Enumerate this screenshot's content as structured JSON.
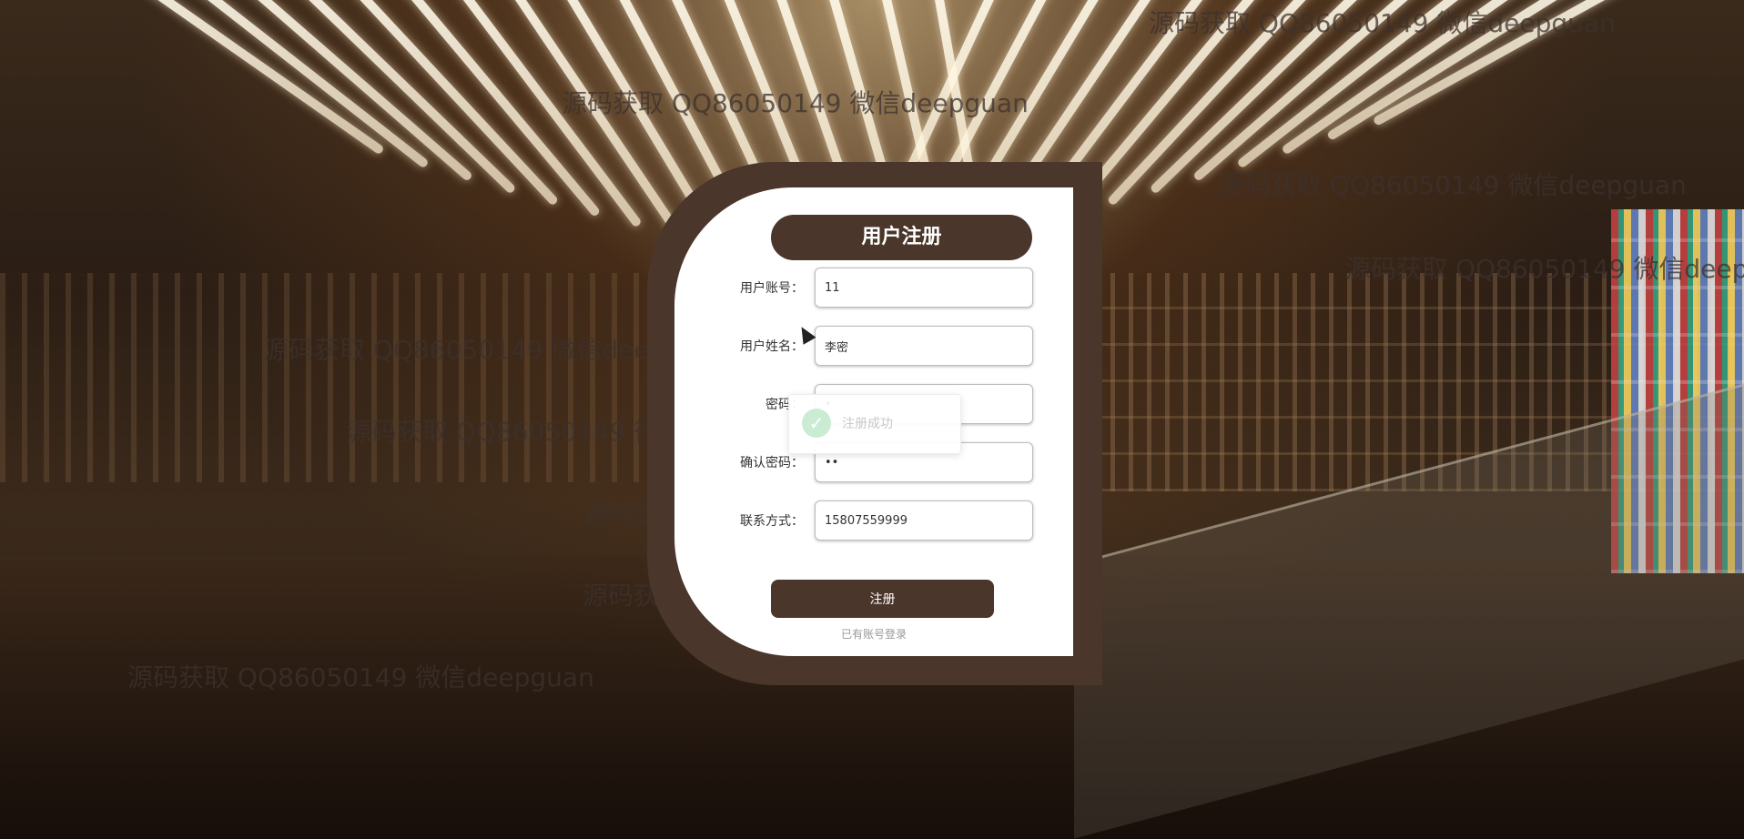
{
  "form": {
    "title": "用户注册",
    "fields": [
      {
        "label": "用户账号：",
        "value": "11",
        "type": "text"
      },
      {
        "label": "用户姓名：",
        "value": "李密",
        "type": "text"
      },
      {
        "label": "密码：",
        "value": "•",
        "type": "text"
      },
      {
        "label": "确认密码：",
        "value": "••",
        "type": "text"
      },
      {
        "label": "联系方式：",
        "value": "15807559999",
        "type": "text"
      }
    ],
    "submit_label": "注册",
    "login_link": "已有账号登录"
  },
  "toast": {
    "message": "注册成功",
    "icon": "check-icon"
  },
  "watermark": "源码获取 QQ86050149 微信deepguan",
  "colors": {
    "brand": "#4a362a",
    "card_inner": "#ffffff",
    "toast_icon": "#c9ecd2"
  }
}
